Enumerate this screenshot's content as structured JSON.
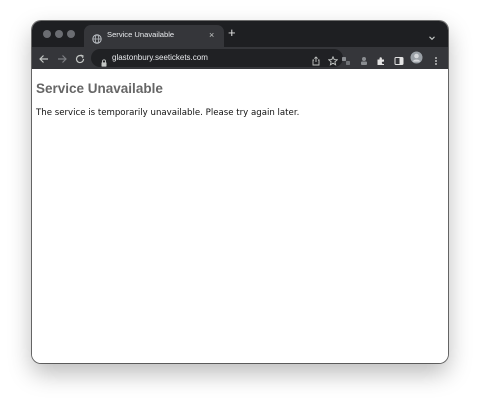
{
  "browser": {
    "tab": {
      "title": "Service Unavailable",
      "close_glyph": "×"
    },
    "new_tab_glyph": "+",
    "address_bar": {
      "url": "glastonbury.seetickets.com"
    },
    "icons": [
      "globe-icon",
      "close-icon",
      "plus-icon",
      "chevron-down-icon",
      "back-arrow-icon",
      "forward-arrow-icon",
      "reload-icon",
      "lock-icon",
      "share-icon",
      "star-icon",
      "extension-icon",
      "puzzle-icon",
      "side-panel-icon",
      "profile-avatar",
      "kebab-menu-icon"
    ]
  },
  "page": {
    "heading": "Service Unavailable",
    "message": "The service is temporarily unavailable. Please try again later."
  }
}
